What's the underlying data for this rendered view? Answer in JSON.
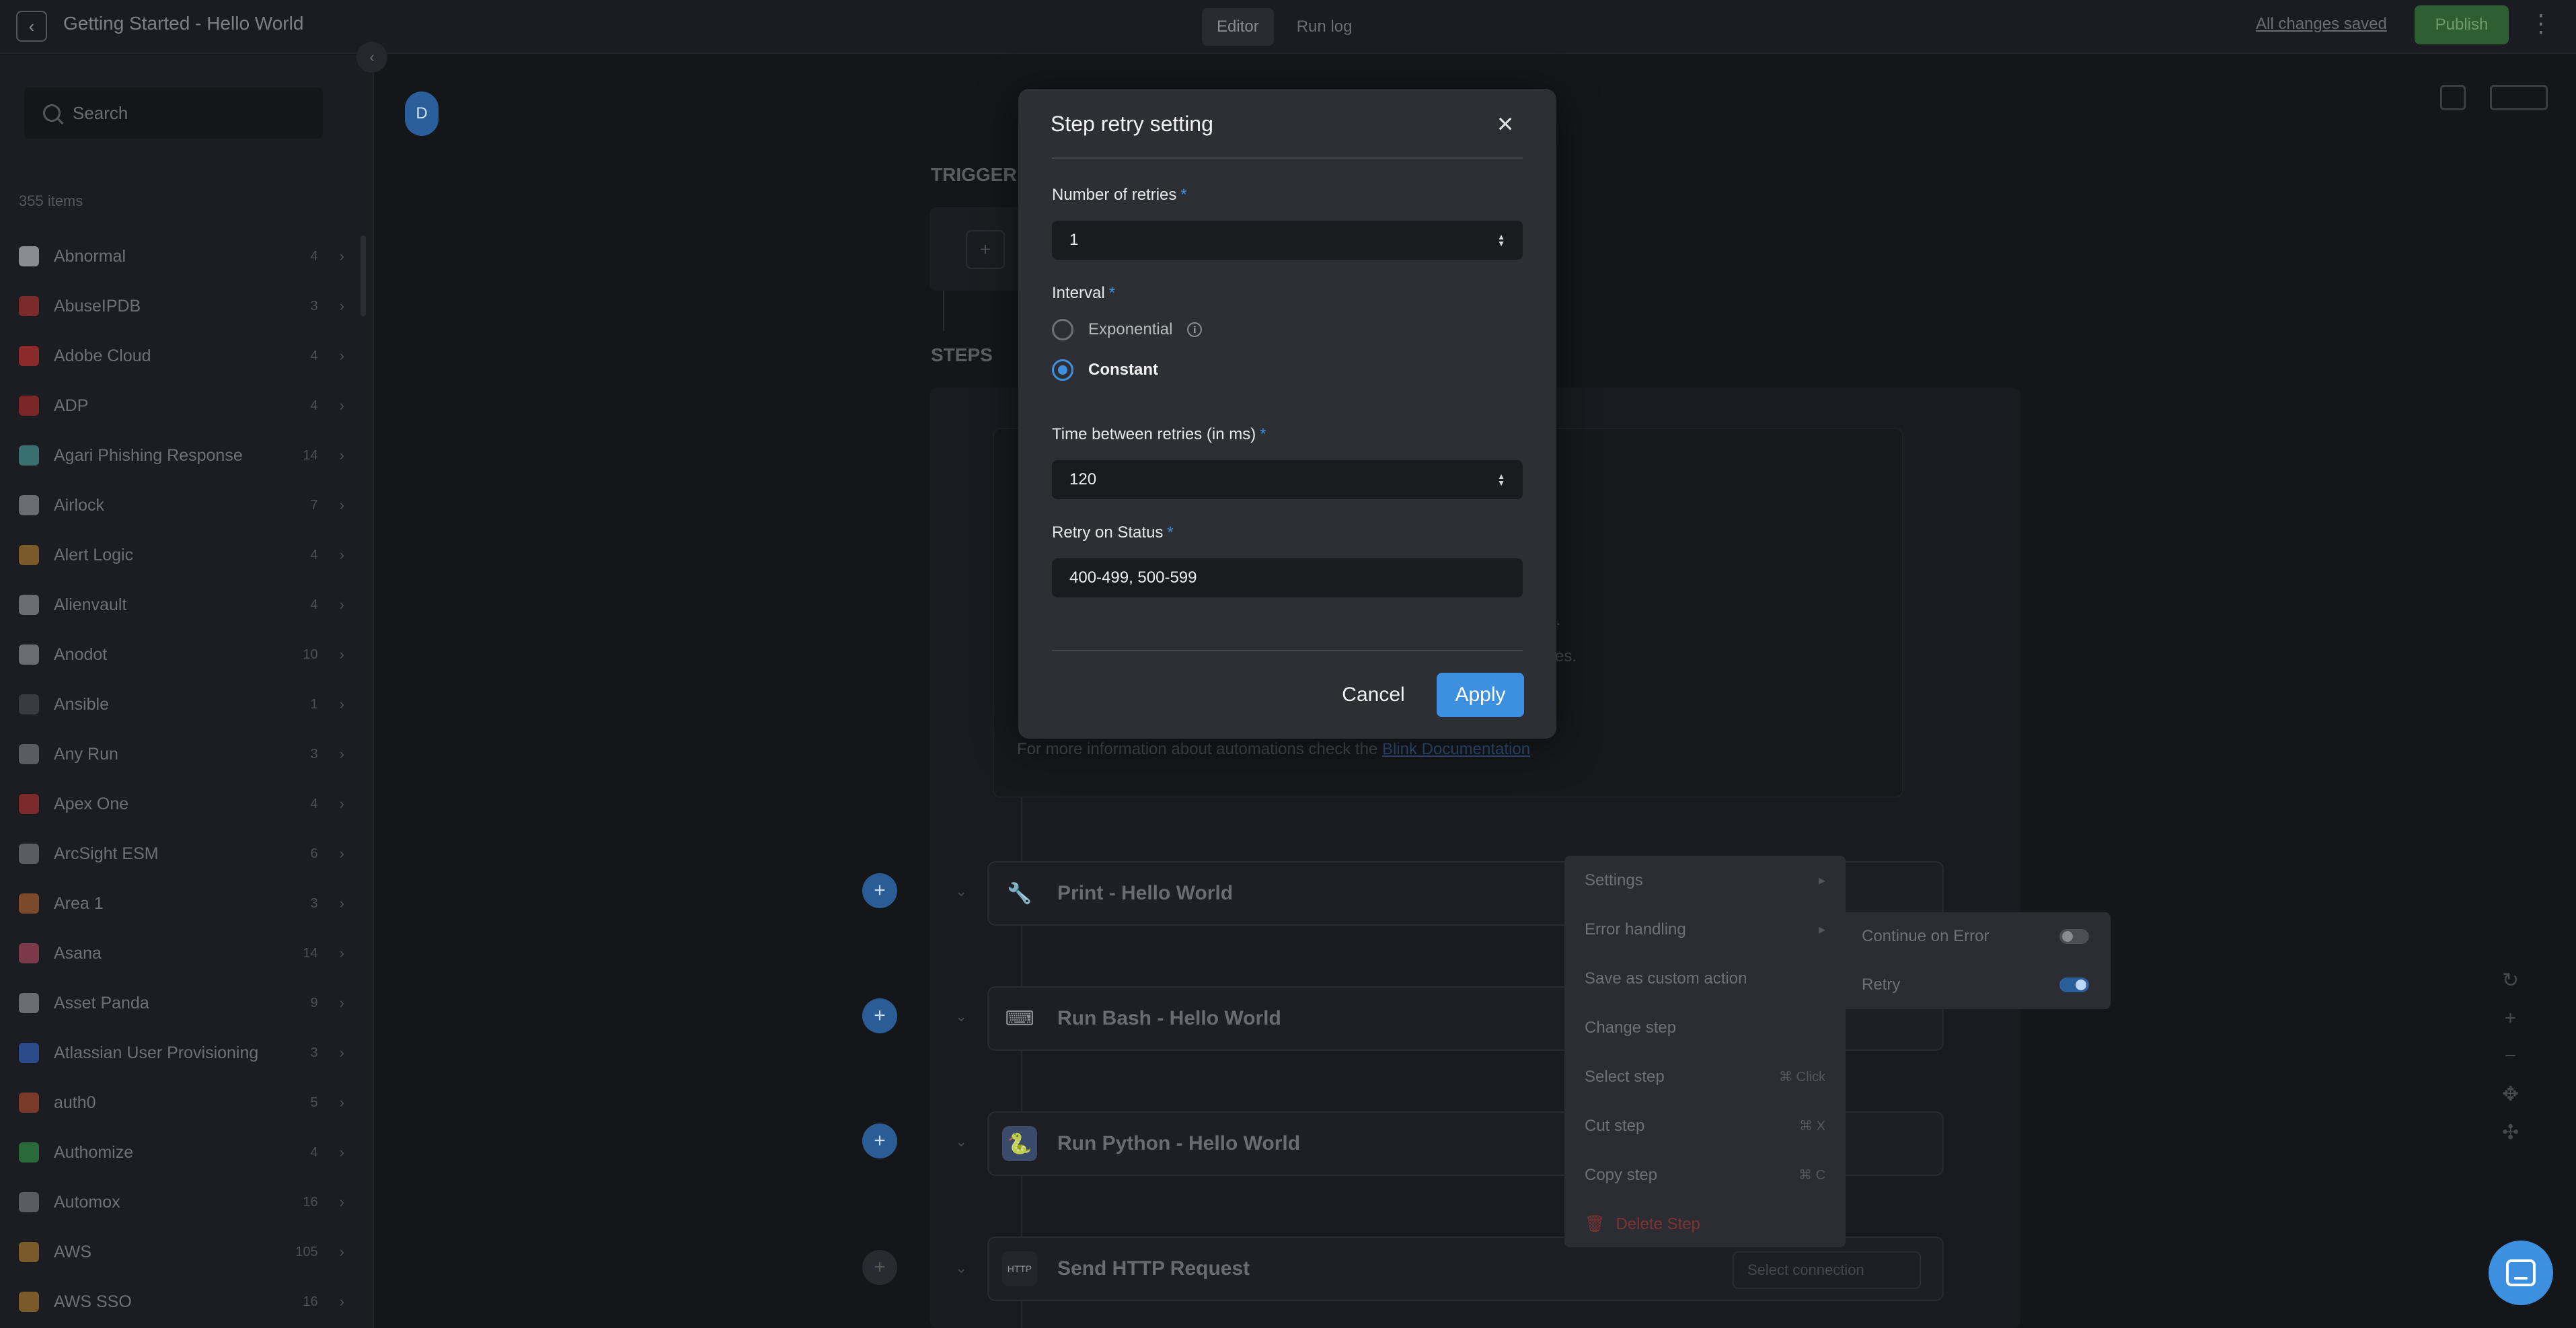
{
  "topbar": {
    "title": "Getting Started - Hello World",
    "tabs": [
      {
        "label": "Editor"
      },
      {
        "label": "Run log"
      }
    ],
    "saved_label": "All changes saved",
    "publish_label": "Publish"
  },
  "sidebar": {
    "search_placeholder": "Search",
    "items_count": "355 items",
    "items": [
      {
        "name": "Abnormal",
        "count": "4",
        "color": "#8a8c92"
      },
      {
        "name": "AbuseIPDB",
        "count": "3",
        "color": "#7a2a2a"
      },
      {
        "name": "Adobe Cloud",
        "count": "4",
        "color": "#8a2a2a"
      },
      {
        "name": "ADP",
        "count": "4",
        "color": "#7a2626"
      },
      {
        "name": "Agari Phishing Response",
        "count": "14",
        "color": "#3a6f6f"
      },
      {
        "name": "Airlock",
        "count": "7",
        "color": "#6a6c72"
      },
      {
        "name": "Alert Logic",
        "count": "4",
        "color": "#7a5a2a"
      },
      {
        "name": "Alienvault",
        "count": "4",
        "color": "#6a6c72"
      },
      {
        "name": "Anodot",
        "count": "10",
        "color": "#6a6c72"
      },
      {
        "name": "Ansible",
        "count": "1",
        "color": "#3a3b40"
      },
      {
        "name": "Any Run",
        "count": "3",
        "color": "#5a5c62"
      },
      {
        "name": "Apex One",
        "count": "4",
        "color": "#7a2a2a"
      },
      {
        "name": "ArcSight ESM",
        "count": "6",
        "color": "#5a5c62"
      },
      {
        "name": "Area 1",
        "count": "3",
        "color": "#7a4a2a"
      },
      {
        "name": "Asana",
        "count": "14",
        "color": "#7a3a4a"
      },
      {
        "name": "Asset Panda",
        "count": "9",
        "color": "#6a6c72"
      },
      {
        "name": "Atlassian User Provisioning",
        "count": "3",
        "color": "#2a4a8a"
      },
      {
        "name": "auth0",
        "count": "5",
        "color": "#7a3a2a"
      },
      {
        "name": "Authomize",
        "count": "4",
        "color": "#2a6a3a"
      },
      {
        "name": "Automox",
        "count": "16",
        "color": "#5a5c62"
      },
      {
        "name": "AWS",
        "count": "105",
        "color": "#7a5a2a"
      },
      {
        "name": "AWS SSO",
        "count": "16",
        "color": "#7a5a2a"
      }
    ]
  },
  "canvas": {
    "avatar_letter": "D",
    "trigger_label": "TRIGGER",
    "steps_label": "STEPS",
    "info_lines": [
      "",
      "",
      "",
      "n.",
      "ves.",
      ""
    ],
    "info_prefix": "For more information about automations check the",
    "info_link": "Blink Documentation",
    "steps": [
      {
        "title": "Print - Hello World",
        "icon": "wrench-icon"
      },
      {
        "title": "Run Bash - Hello World",
        "icon": "bash-icon"
      },
      {
        "title": "Run Python - Hello World",
        "icon": "python-icon"
      },
      {
        "title": "Send HTTP Request",
        "icon": "http-icon"
      }
    ],
    "http_select_placeholder": "Select connection",
    "http_badge": "HTTP"
  },
  "context_menu": {
    "items": [
      {
        "label": "Settings",
        "shortcut": "",
        "submenu": true
      },
      {
        "label": "Error handling",
        "shortcut": "",
        "submenu": true
      },
      {
        "label": "Save as custom action",
        "shortcut": ""
      },
      {
        "label": "Change step",
        "shortcut": ""
      },
      {
        "label": "Select step",
        "shortcut": "⌘ Click"
      },
      {
        "label": "Cut step",
        "shortcut": "⌘ X"
      },
      {
        "label": "Copy step",
        "shortcut": "⌘ C"
      },
      {
        "label": "Delete Step",
        "shortcut": "",
        "danger": true
      }
    ],
    "submenu": [
      {
        "label": "Continue on Error",
        "on": false
      },
      {
        "label": "Retry",
        "on": true
      }
    ]
  },
  "modal": {
    "title": "Step retry setting",
    "retries_label": "Number of retries",
    "retries_value": "1",
    "interval_label": "Interval",
    "interval_options": [
      {
        "label": "Exponential",
        "checked": false
      },
      {
        "label": "Constant",
        "checked": true
      }
    ],
    "time_label": "Time between retries (in ms)",
    "time_value": "120",
    "status_label": "Retry on Status",
    "status_value": "400-499, 500-599",
    "cancel_label": "Cancel",
    "apply_label": "Apply"
  },
  "colors": {
    "accent": "#3d8fe0",
    "publish": "#2e5f32",
    "danger": "#7a3434"
  }
}
